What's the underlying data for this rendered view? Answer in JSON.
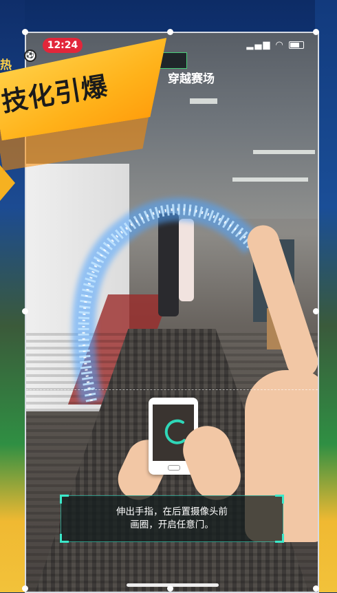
{
  "status_bar": {
    "time": "12:24",
    "signal": "ııl",
    "wifi": "wifi"
  },
  "nav": {
    "back_glyph": "‹",
    "title": "穿越赛场",
    "scoreboard_text": ""
  },
  "banner": {
    "text": "技化引爆",
    "hot_glyph": "热"
  },
  "hint": {
    "text": "伸出手指，在后置摄像头前\n画圈，开启任意门。"
  },
  "colors": {
    "time_pill": "#e2263a",
    "hint_border": "#3be8c9",
    "banner": "#ffb21a"
  },
  "icons": [
    "back-arrow-icon",
    "signal-icon",
    "wifi-icon",
    "battery-icon",
    "football-icon"
  ]
}
